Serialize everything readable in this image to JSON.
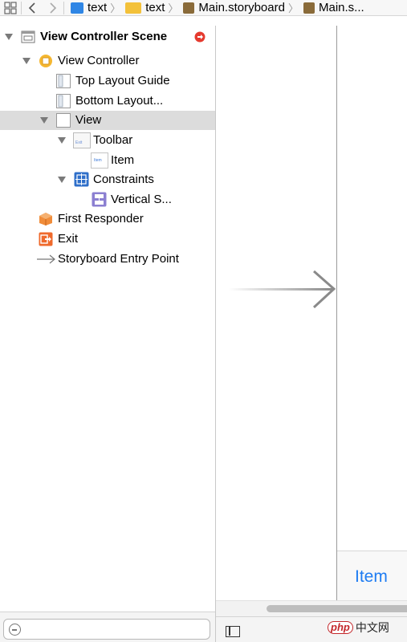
{
  "jumpbar": {
    "crumbs": [
      {
        "label": "text",
        "icon": "project-file-icon"
      },
      {
        "label": "text",
        "icon": "folder-icon"
      },
      {
        "label": "Main.storyboard",
        "icon": "storyboard-file-icon"
      },
      {
        "label": "Main.s...",
        "icon": "storyboard-file-icon"
      }
    ]
  },
  "outline": {
    "scene": "View Controller Scene",
    "view_controller": "View Controller",
    "top_layout_guide": "Top Layout Guide",
    "bottom_layout_guide": "Bottom Layout...",
    "view": "View",
    "toolbar": "Toolbar",
    "toolbar_exit_icon_text": "Exit",
    "item": "Item",
    "item_icon_text": "Item",
    "constraints": "Constraints",
    "vertical_spacing": "Vertical S...",
    "first_responder": "First Responder",
    "exit": "Exit",
    "entry_point": "Storyboard Entry Point"
  },
  "canvas": {
    "toolbar_item": "Item"
  },
  "watermark": {
    "logo": "php",
    "text": "中文网"
  },
  "colors": {
    "accent_blue": "#1e7cf2",
    "selection_gray": "#dcdcdc",
    "scene_badge_red": "#e53a2f",
    "responder_orange": "#f08c3a",
    "vc_yellow": "#f5b731"
  }
}
